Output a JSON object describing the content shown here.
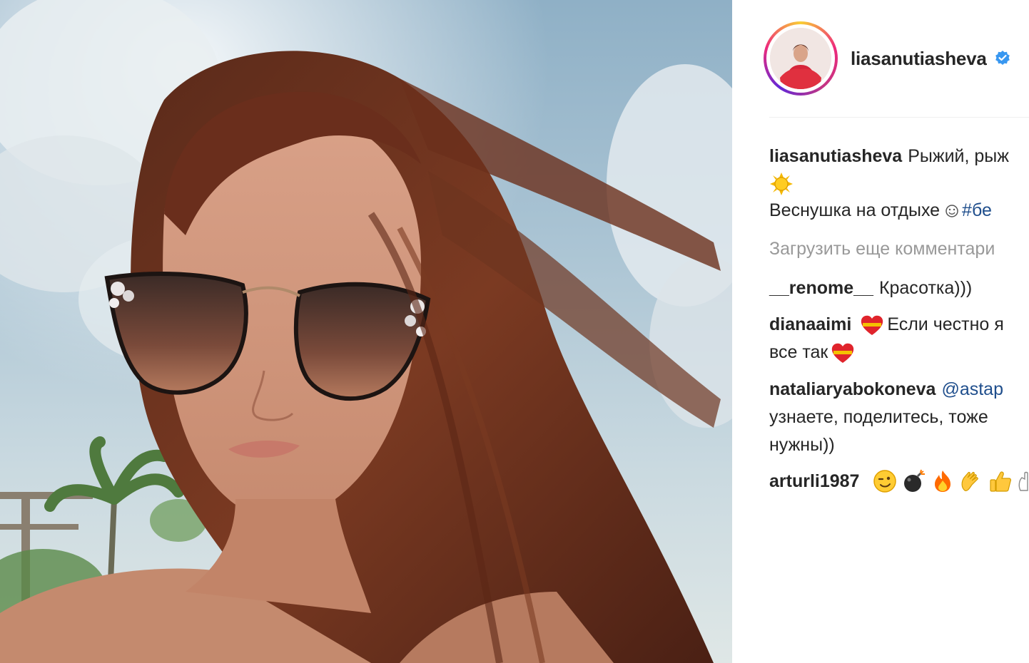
{
  "post": {
    "username": "liasanutiasheva",
    "verified": true
  },
  "caption": {
    "username": "liasanutiasheva",
    "text": "Рыжий, рыж",
    "line3": "Веснушка на отдыхе",
    "hashtag": "#бе"
  },
  "load_more_label": "Загрузить еще комментари",
  "comments": [
    {
      "username": "__renome__",
      "text": "Красотка)))"
    },
    {
      "username": "dianaaimi",
      "text": "Если честно я",
      "continuation": "все так"
    },
    {
      "username": "nataliaryabokoneva",
      "mention": "@astap",
      "continuation": "узнаете, поделитесь, тоже",
      "continuation2": "нужны))"
    },
    {
      "username": "arturli1987",
      "emojis": [
        "wink-face-icon",
        "bomb-icon",
        "fire-icon",
        "clapping-hands-icon",
        "thumbs-up-icon",
        "hand-icon"
      ]
    }
  ],
  "colors": {
    "text": "#262626",
    "muted": "#999999",
    "link": "#1f4e8c",
    "verified": "#3897f0",
    "heart": "#e0242c"
  }
}
